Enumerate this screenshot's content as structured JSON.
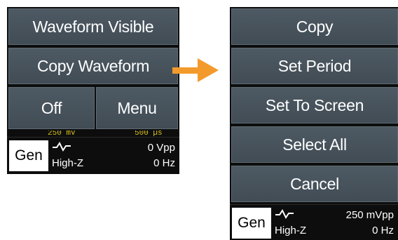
{
  "left_menu": {
    "waveform_visible": "Waveform Visible",
    "copy_waveform": "Copy Waveform",
    "off": "Off",
    "menu": "Menu",
    "readout_left": "250 mV",
    "readout_right": "500 µs"
  },
  "left_gen": {
    "label": "Gen",
    "impedance": "High-Z",
    "amplitude": "0 Vpp",
    "frequency": "0 Hz"
  },
  "right_menu": {
    "items": [
      "Copy",
      "Set Period",
      "Set To Screen",
      "Select All",
      "Cancel"
    ]
  },
  "right_gen": {
    "label": "Gen",
    "impedance": "High-Z",
    "amplitude": "250 mVpp",
    "frequency": "0 Hz"
  },
  "colors": {
    "button": "#4a555e",
    "arrow": "#f39a2c",
    "readout": "#d8c020"
  },
  "icons": {
    "waveform": "sine-wave-icon",
    "transition": "arrow-right-icon"
  }
}
